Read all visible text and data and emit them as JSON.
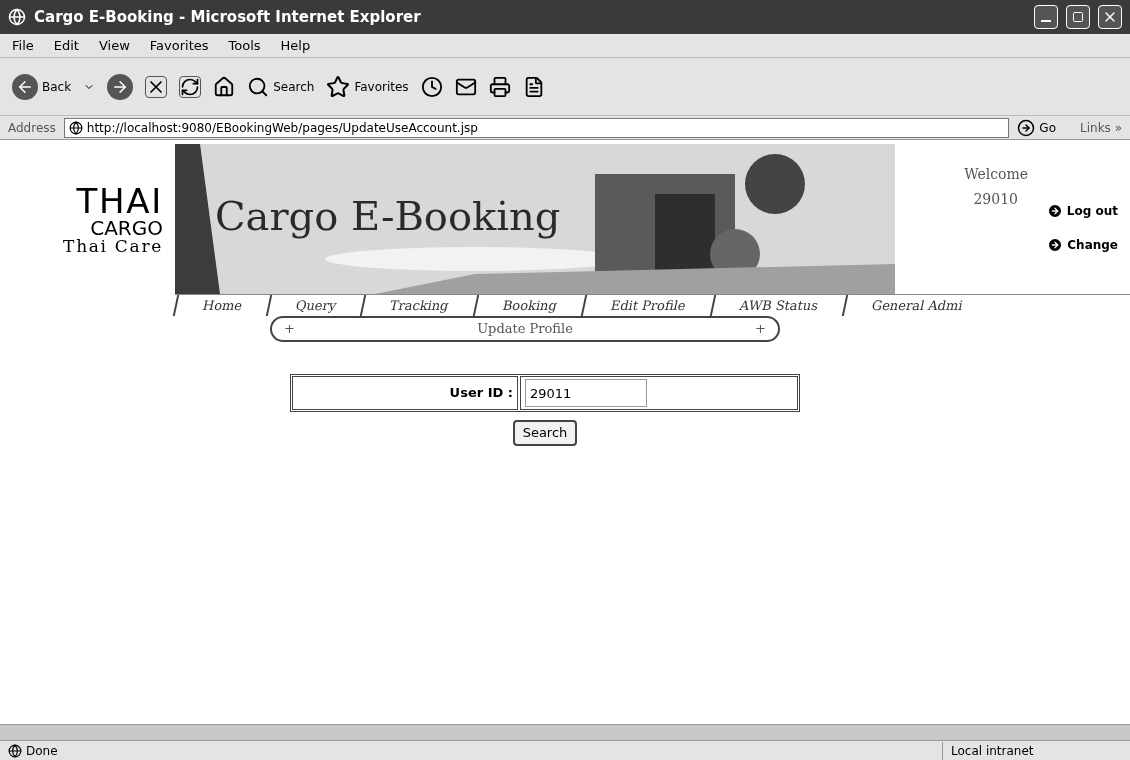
{
  "window": {
    "title": "Cargo E-Booking - Microsoft Internet Explorer"
  },
  "menu": [
    "File",
    "Edit",
    "View",
    "Favorites",
    "Tools",
    "Help"
  ],
  "toolbar": {
    "back": "Back",
    "search": "Search",
    "favorites": "Favorites"
  },
  "address": {
    "label": "Address",
    "url": "http://localhost:9080/EBookingWeb/pages/UpdateUseAccount.jsp",
    "go": "Go",
    "links": "Links",
    "chevron": "»"
  },
  "banner": {
    "logo": [
      "THAI",
      "CARGO",
      "Thai Care"
    ],
    "title": "Cargo E-Booking",
    "welcome": "Welcome",
    "user": "29010",
    "links": [
      "Log out",
      "Change"
    ]
  },
  "nav": [
    "Home",
    "Query",
    "Tracking",
    "Booking",
    "Edit Profile",
    "AWB Status",
    "General Admi"
  ],
  "section": {
    "title": "Update Profile",
    "marks": [
      "+",
      "+"
    ]
  },
  "form": {
    "label": "User ID :",
    "value": "29011",
    "button": "Search"
  },
  "status_bar": {
    "text": "Done",
    "zone": "Local intranet"
  }
}
